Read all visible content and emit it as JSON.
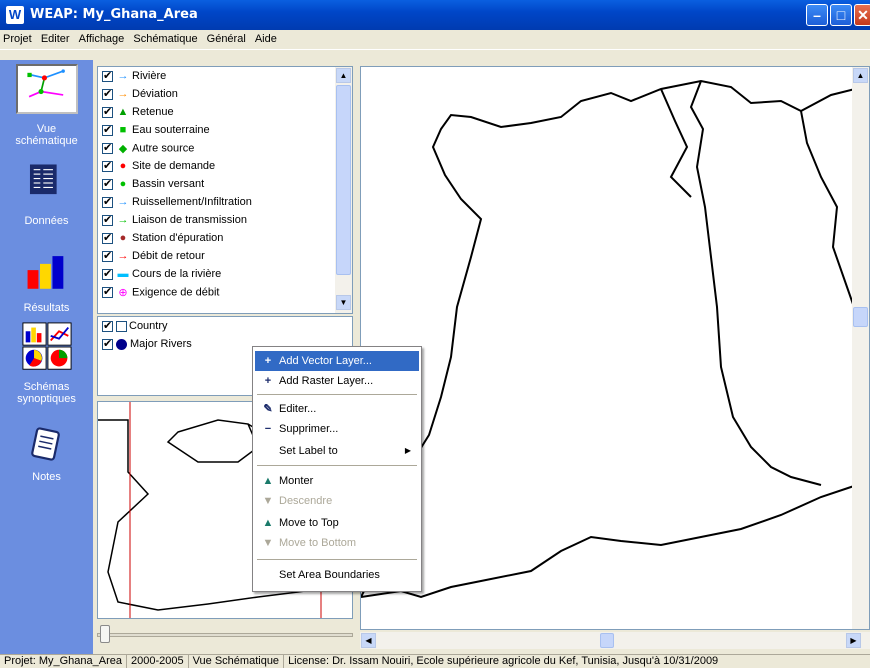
{
  "window": {
    "title": "WEAP: My_Ghana_Area",
    "app_icon": "W"
  },
  "menu": [
    "Projet",
    "Editer",
    "Affichage",
    "Schématique",
    "Général",
    "Aide"
  ],
  "sidebar": [
    {
      "label_1": "Vue",
      "label_2": "schématique",
      "icon": "schematic-icon"
    },
    {
      "label_1": "Données",
      "label_2": "",
      "icon": "data-icon"
    },
    {
      "label_1": "Résultats",
      "label_2": "",
      "icon": "results-icon"
    },
    {
      "label_1": "Schémas",
      "label_2": "synoptiques",
      "icon": "overviews-icon"
    },
    {
      "label_1": "Notes",
      "label_2": "",
      "icon": "notes-icon"
    }
  ],
  "legend_items": [
    {
      "label": "Rivière",
      "symbol": "→",
      "color": "#1e90ff"
    },
    {
      "label": "Déviation",
      "symbol": "→",
      "color": "#ff8c00"
    },
    {
      "label": "Retenue",
      "symbol": "▲",
      "color": "#00a000"
    },
    {
      "label": "Eau souterraine",
      "symbol": "■",
      "color": "#00c000"
    },
    {
      "label": "Autre source",
      "symbol": "◆",
      "color": "#00b000"
    },
    {
      "label": "Site de demande",
      "symbol": "●",
      "color": "#ff0000"
    },
    {
      "label": "Bassin versant",
      "symbol": "●",
      "color": "#00c000"
    },
    {
      "label": "Ruissellement/Infiltration",
      "symbol": "→",
      "color": "#1e90ff"
    },
    {
      "label": "Liaison de transmission",
      "symbol": "→",
      "color": "#00c000"
    },
    {
      "label": "Station d'épuration",
      "symbol": "●",
      "color": "#a52a2a"
    },
    {
      "label": "Débit de retour",
      "symbol": "→",
      "color": "#ff0000"
    },
    {
      "label": "Cours de la rivière",
      "symbol": "▬",
      "color": "#00bfff"
    },
    {
      "label": "Exigence de débit",
      "symbol": "⊕",
      "color": "#ff00ff"
    }
  ],
  "layers": [
    {
      "label": "Country",
      "checked": true,
      "swatch": "square"
    },
    {
      "label": "Major Rivers",
      "checked": true,
      "swatch": "dot"
    }
  ],
  "context_menu": [
    {
      "label": "Add Vector Layer...",
      "icon": "+",
      "selected": true,
      "disabled": false
    },
    {
      "label": "Add Raster Layer...",
      "icon": "+",
      "selected": false,
      "disabled": false
    },
    {
      "label": "Editer...",
      "icon": "✎",
      "selected": false,
      "disabled": false
    },
    {
      "label": "Supprimer...",
      "icon": "−",
      "selected": false,
      "disabled": false
    },
    {
      "label": "Set Label to",
      "icon": "",
      "selected": false,
      "disabled": false,
      "submenu": true
    },
    {
      "label": "Monter",
      "icon": "▲",
      "selected": false,
      "disabled": false
    },
    {
      "label": "Descendre",
      "icon": "▼",
      "selected": false,
      "disabled": true
    },
    {
      "label": "Move to Top",
      "icon": "▲",
      "selected": false,
      "disabled": false
    },
    {
      "label": "Move to Bottom",
      "icon": "▼",
      "selected": false,
      "disabled": true
    },
    {
      "label": "Set Area Boundaries",
      "icon": "",
      "selected": false,
      "disabled": false
    }
  ],
  "status": [
    "Projet: My_Ghana_Area",
    "2000-2005",
    "Vue Schématique",
    "License: Dr. Issam Nouiri, Ecole supérieure agricole du Kef, Tunisia, Jusqu'à 10/31/2009"
  ]
}
